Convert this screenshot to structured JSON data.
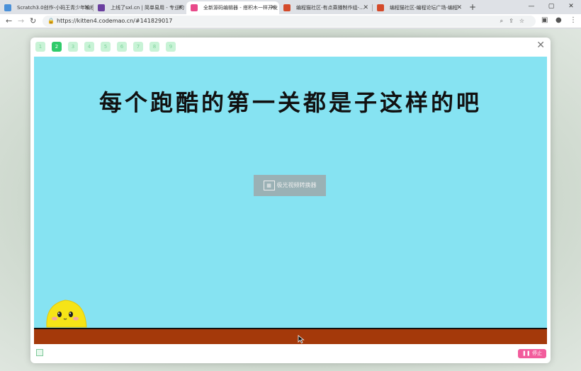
{
  "browser": {
    "tabs": [
      {
        "title": "Scratch3.0创作-小码王青少年编程",
        "fav_color": "#4a90d9",
        "active": false
      },
      {
        "title": "上线了sxl.cn | 简单易用 - 专业的",
        "fav_color": "#6b3fa0",
        "active": false
      },
      {
        "title": "全新源码编辑器 - 搭积木一样开发",
        "fav_color": "#e84a8a",
        "active": true
      },
      {
        "title": "编程猫社区-有点乘播制作组-…",
        "fav_color": "#d44a2a",
        "active": false
      },
      {
        "title": "编程猫社区-编程论坛广场-编程",
        "fav_color": "#d44a2a",
        "active": false
      }
    ],
    "tab_close": "✕",
    "new_tab": "+",
    "url": "https://kitten4.codemao.cn/#141829017"
  },
  "player": {
    "pages": [
      "1",
      "2",
      "3",
      "4",
      "5",
      "6",
      "7",
      "8",
      "9"
    ],
    "active_page": 1,
    "close": "✕",
    "stage_title": "每个跑酷的第一关都是子这样的吧",
    "watermark": "极光视频转换器",
    "stop_label": "停止",
    "colors": {
      "stage": "#86e3f2",
      "ground": "#a4390a",
      "accent": "#2fcb6a",
      "stop": "#f25c9c"
    }
  }
}
